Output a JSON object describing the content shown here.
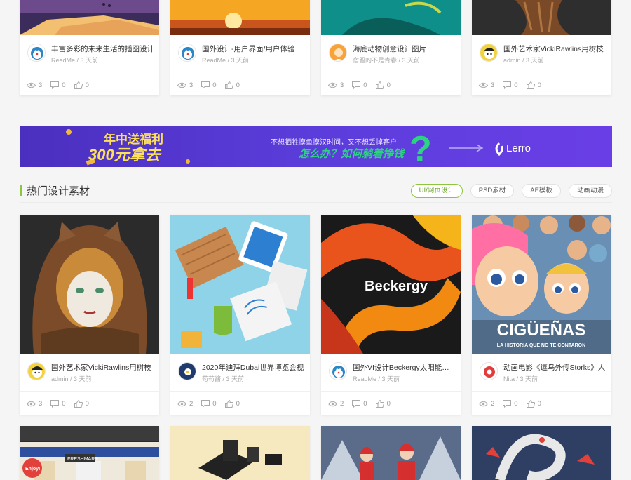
{
  "row1": [
    {
      "title": "丰富多彩的未来生活的插图设计",
      "author": "ReadMe",
      "time": "3 天前",
      "views": "3",
      "comments": "0",
      "likes": "0"
    },
    {
      "title": "国外设计-用户界面/用户体验",
      "author": "ReadMe",
      "time": "3 天前",
      "views": "3",
      "comments": "0",
      "likes": "0"
    },
    {
      "title": "海底动物创意设计图片",
      "author": "宿留的不是青春",
      "time": "3 天前",
      "views": "3",
      "comments": "0",
      "likes": "0"
    },
    {
      "title": "国外艺术家VickiRawlins用树枝",
      "author": "admin",
      "time": "3 天前",
      "views": "3",
      "comments": "0",
      "likes": "0"
    }
  ],
  "banner": {
    "headline1": "年中送福利",
    "headline2": "300元拿去",
    "line1": "不想牺牲摸鱼摸汉时间，又不想丢掉客户",
    "line2": "怎么办？如何躺着挣钱",
    "qmark": "?",
    "logo": "Lerro"
  },
  "section": {
    "title": "热门设计素材",
    "tabs": [
      "UI/网页设计",
      "PSD素材",
      "AE模板",
      "动画动漫"
    ]
  },
  "row2": [
    {
      "title": "国外艺术家VickiRawlins用树枝",
      "author": "admin",
      "time": "3 天前",
      "views": "3",
      "comments": "0",
      "likes": "0"
    },
    {
      "title": "2020年迪拜Dubai世界博览会视",
      "author": "苟苟酱",
      "time": "3 天前",
      "views": "2",
      "comments": "0",
      "likes": "0"
    },
    {
      "title": "国外VI设计Beckergy太阳能电池",
      "author": "ReadMe",
      "time": "3 天前",
      "views": "2",
      "comments": "0",
      "likes": "0"
    },
    {
      "title": "动画电影《逗鸟外传Storks》人",
      "author": "Nita",
      "time": "3 天前",
      "views": "2",
      "comments": "0",
      "likes": "0"
    }
  ],
  "thumb_text": {
    "beckergy": "Beckergy",
    "ciguenas": "CIGÜEÑAS",
    "ciguenas_sub": "LA HISTORIA QUE NO TE CONTARON",
    "enjoy": "Enjoy!",
    "freshmart": "FRESHMART"
  },
  "sub_separator": " / ",
  "colors": {
    "accent": "#8cc63f",
    "banner_bg": "#5a3fd8",
    "banner_accent": "#2bd47f"
  }
}
